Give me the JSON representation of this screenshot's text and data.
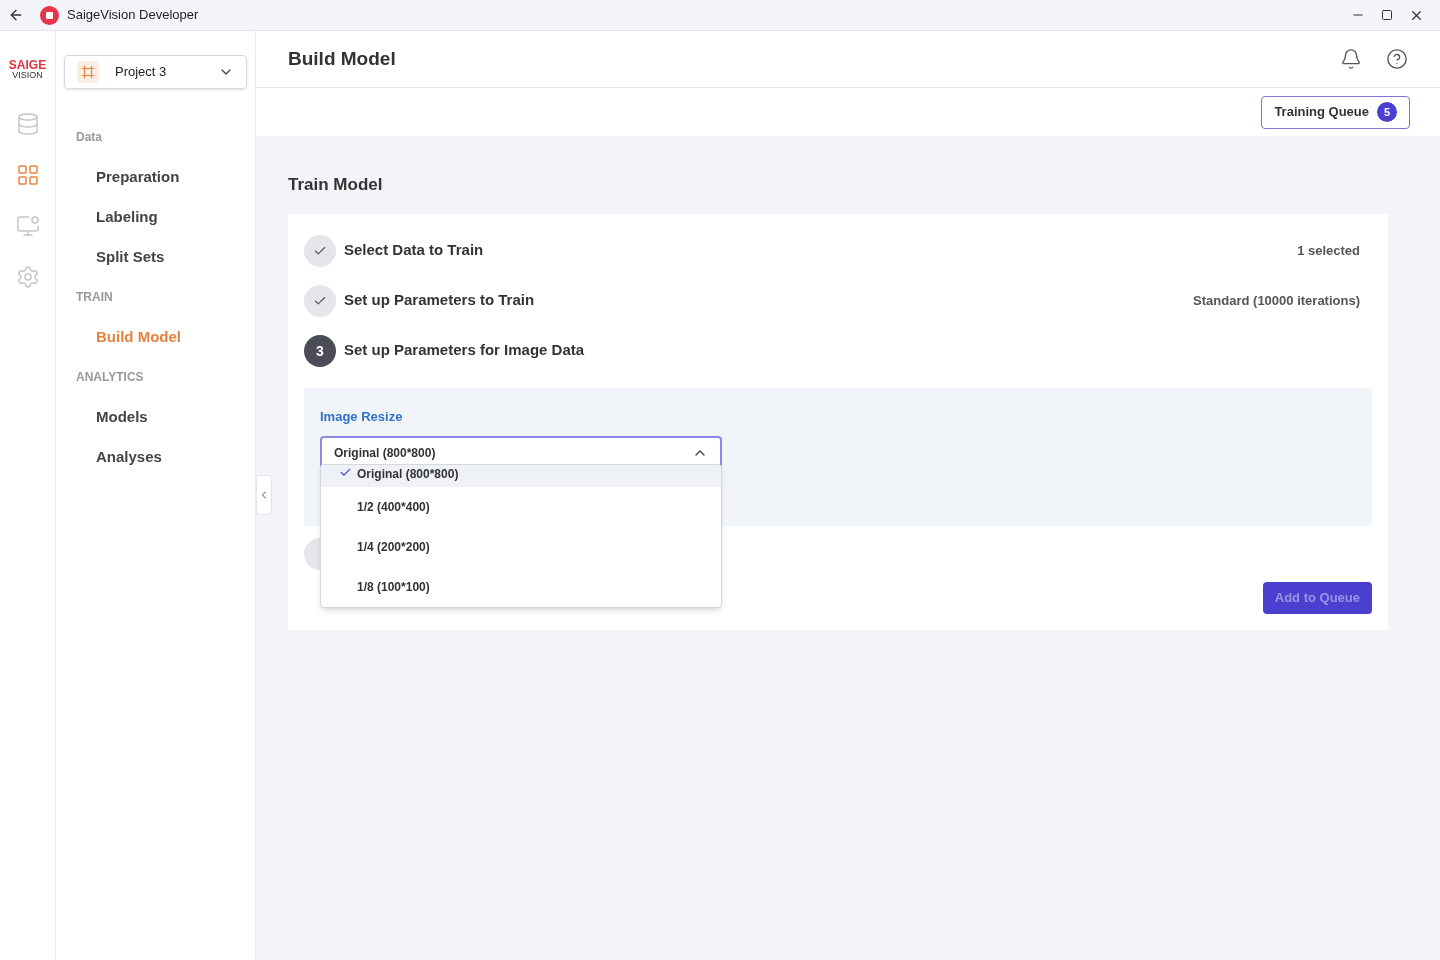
{
  "window": {
    "title": "SaigeVision Developer"
  },
  "logo": {
    "top": "SAIGE",
    "bottom": "VISION"
  },
  "rail": [
    {
      "kind": "database",
      "selected": false
    },
    {
      "kind": "grid",
      "selected": true
    },
    {
      "kind": "monitor",
      "selected": false
    },
    {
      "kind": "settings",
      "selected": false
    }
  ],
  "project": {
    "name": "Project 3"
  },
  "nav": [
    {
      "heading": "Data",
      "items": [
        {
          "label": "Preparation",
          "selected": false
        },
        {
          "label": "Labeling",
          "selected": false
        },
        {
          "label": "Split Sets",
          "selected": false
        }
      ]
    },
    {
      "heading": "TRAIN",
      "items": [
        {
          "label": "Build Model",
          "selected": true
        }
      ]
    },
    {
      "heading": "ANALYTICS",
      "items": [
        {
          "label": "Models",
          "selected": false
        },
        {
          "label": "Analyses",
          "selected": false
        }
      ]
    }
  ],
  "page": {
    "title": "Build Model"
  },
  "training_queue": {
    "label": "Training Queue",
    "count": "5"
  },
  "section": {
    "title": "Train Model"
  },
  "steps": [
    {
      "kind": "done",
      "label": "Select Data to Train",
      "summary": "1 selected"
    },
    {
      "kind": "done",
      "label": "Set up Parameters to Train",
      "summary": "Standard (10000 iterations)"
    },
    {
      "kind": "current",
      "number": "3",
      "label": "Set up Parameters for Image Data"
    }
  ],
  "image_resize": {
    "label": "Image Resize",
    "value": "Original (800*800)",
    "expanded": true,
    "options": [
      {
        "label": "Original (800*800)",
        "selected": true
      },
      {
        "label": "1/2 (400*400)",
        "selected": false
      },
      {
        "label": "1/4 (200*200)",
        "selected": false
      },
      {
        "label": "1/8 (100*100)",
        "selected": false
      }
    ]
  },
  "add_button": {
    "label": "Add to Queue",
    "disabled": true
  }
}
